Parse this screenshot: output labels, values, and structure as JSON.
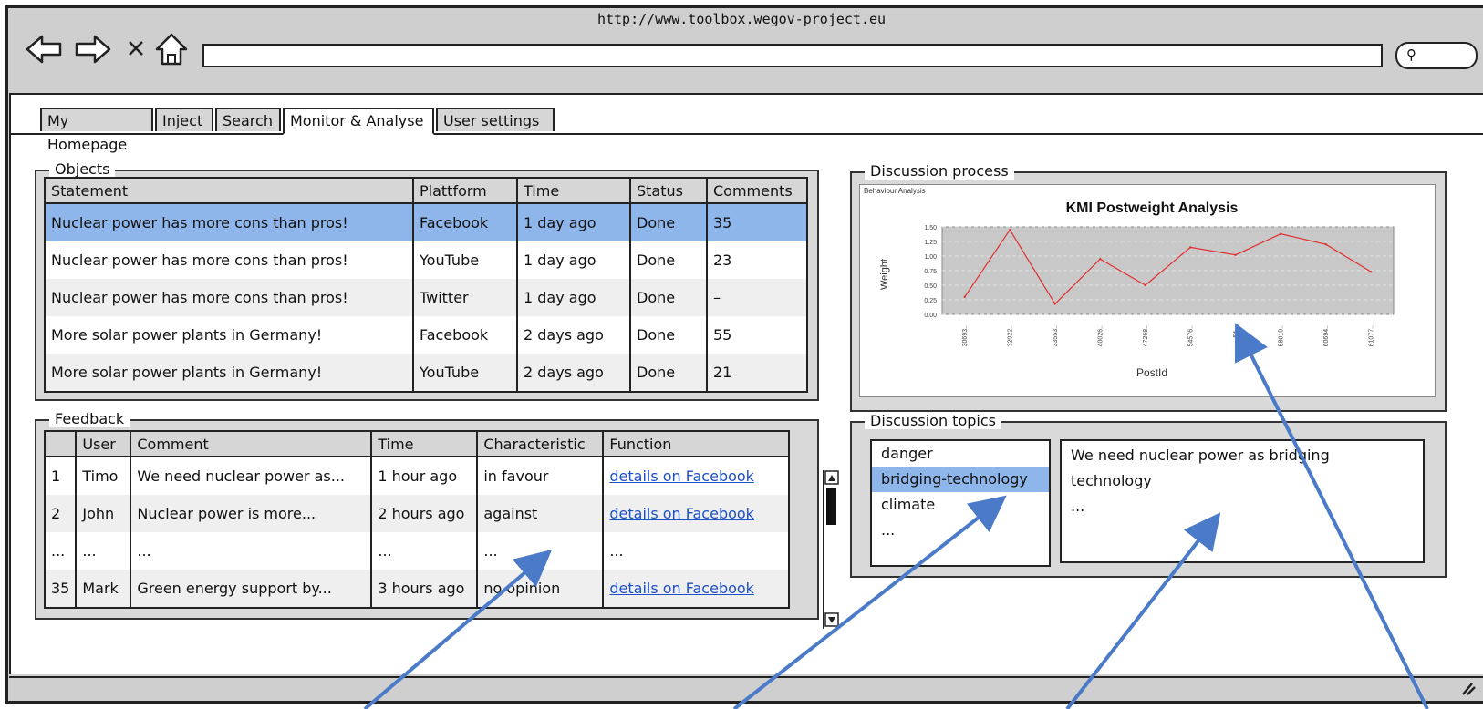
{
  "browser": {
    "url": "http://www.toolbox.wegov-project.eu"
  },
  "tabs": [
    {
      "label": "My Homepage"
    },
    {
      "label": "Inject"
    },
    {
      "label": "Search"
    },
    {
      "label": "Monitor & Analyse"
    },
    {
      "label": "User settings"
    }
  ],
  "objects": {
    "title": "Objects",
    "columns": [
      "Statement",
      "Plattform",
      "Time",
      "Status",
      "Comments"
    ],
    "rows": [
      [
        "Nuclear power has more cons than pros!",
        "Facebook",
        "1 day ago",
        "Done",
        "35"
      ],
      [
        "Nuclear power has more cons than pros!",
        "YouTube",
        "1 day ago",
        "Done",
        "23"
      ],
      [
        "Nuclear power has more cons than pros!",
        "Twitter",
        "1 day ago",
        "Done",
        "–"
      ],
      [
        "More solar power plants in Germany!",
        "Facebook",
        "2 days ago",
        "Done",
        "55"
      ],
      [
        "More solar power plants in Germany!",
        "YouTube",
        "2 days ago",
        "Done",
        "21"
      ]
    ]
  },
  "feedback": {
    "title": "Feedback",
    "columns": [
      "",
      "User",
      "Comment",
      "Time",
      "Characteristic",
      "Function"
    ],
    "rows": [
      [
        "1",
        "Timo",
        "We need nuclear power as...",
        "1 hour ago",
        "in favour",
        "details on Facebook"
      ],
      [
        "2",
        "John",
        "Nuclear power is more...",
        "2 hours ago",
        "against",
        "details on Facebook"
      ],
      [
        "...",
        "...",
        "...",
        "...",
        "...",
        "..."
      ],
      [
        "35",
        "Mark",
        "Green energy support by...",
        "3 hours ago",
        "no opinion",
        "details on Facebook"
      ]
    ]
  },
  "discussion_process": {
    "title": "Discussion process",
    "chart_caption": "Behaviour Analysis"
  },
  "discussion_topics": {
    "title": "Discussion topics",
    "items": [
      "danger",
      "bridging-technology",
      "climate",
      "..."
    ],
    "selected": 1,
    "detail_lines": [
      "We need nuclear power as bridging",
      "technology",
      "..."
    ]
  },
  "colors": {
    "selection": "#8fb6ea",
    "link": "#1d4fc6",
    "annotation_arrow": "#4a7ac8",
    "chart_line": "#e03030",
    "chart_plot_bg": "#c8c8c8"
  },
  "chart_data": {
    "type": "line",
    "title": "KMI Postweight Analysis",
    "xlabel": "PostId",
    "ylabel": "Weight",
    "categories": [
      "30693..",
      "32022..",
      "33553..",
      "40026..",
      "47268..",
      "54576..",
      "54...",
      "58019..",
      "60694..",
      "61077.."
    ],
    "series": [
      {
        "values": [
          0.3,
          1.45,
          0.18,
          0.95,
          0.5,
          1.15,
          1.02,
          1.38,
          1.2,
          0.73
        ]
      }
    ],
    "yticks": [
      "0.00",
      "0.25",
      "0.50",
      "0.75",
      "1.00",
      "1.25",
      "1.50"
    ],
    "ylim": [
      0,
      1.5
    ],
    "grid": true
  }
}
